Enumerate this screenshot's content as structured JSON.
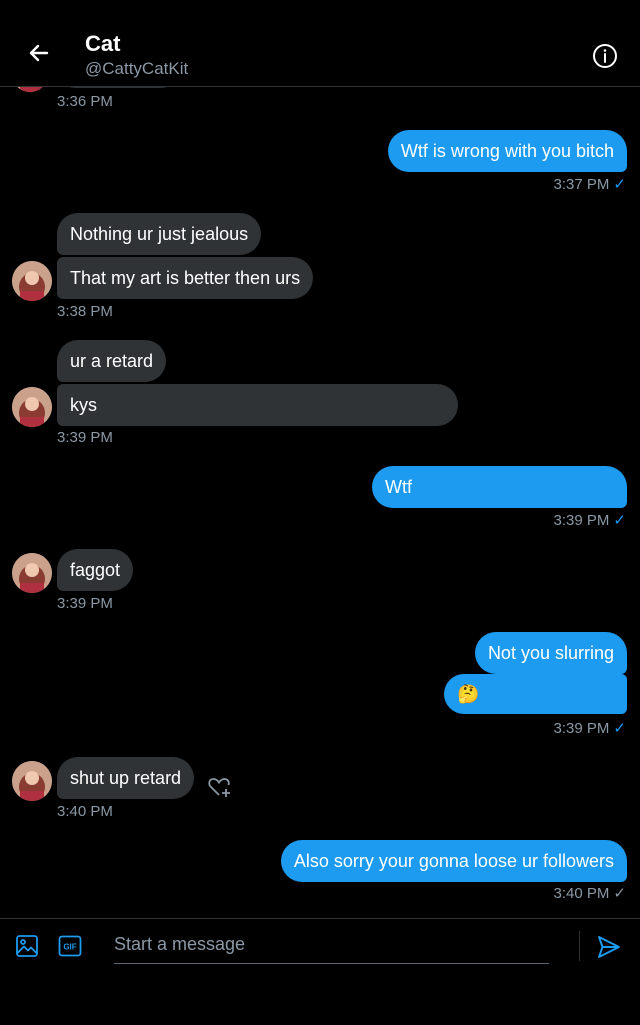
{
  "header": {
    "title": "Cat",
    "handle": "@CattyCatKit"
  },
  "composer": {
    "placeholder": "Start a message"
  },
  "messages": [
    {
      "direction": "in",
      "text": "",
      "time": "3:36 PM"
    },
    {
      "direction": "out",
      "text": "Wtf is wrong with you bitch",
      "time": "3:37 PM",
      "check": "✓"
    },
    {
      "direction": "in",
      "texts": [
        "Nothing ur just jealous",
        "That my art is better then urs"
      ],
      "time": "3:38 PM"
    },
    {
      "direction": "in",
      "texts": [
        "ur a retard",
        "kys"
      ],
      "time": "3:39 PM"
    },
    {
      "direction": "out",
      "text": "Wtf",
      "time": "3:39 PM",
      "check": "✓"
    },
    {
      "direction": "in",
      "text": "faggot",
      "time": "3:39 PM"
    },
    {
      "direction": "out",
      "texts": [
        "Not you slurring",
        "🤔"
      ],
      "time": "3:39 PM",
      "check": "✓"
    },
    {
      "direction": "in",
      "text": "shut up retard",
      "time": "3:40 PM"
    },
    {
      "direction": "out",
      "text": "Also sorry your gonna loose ur followers",
      "time": "3:40 PM",
      "check": "✓"
    }
  ]
}
